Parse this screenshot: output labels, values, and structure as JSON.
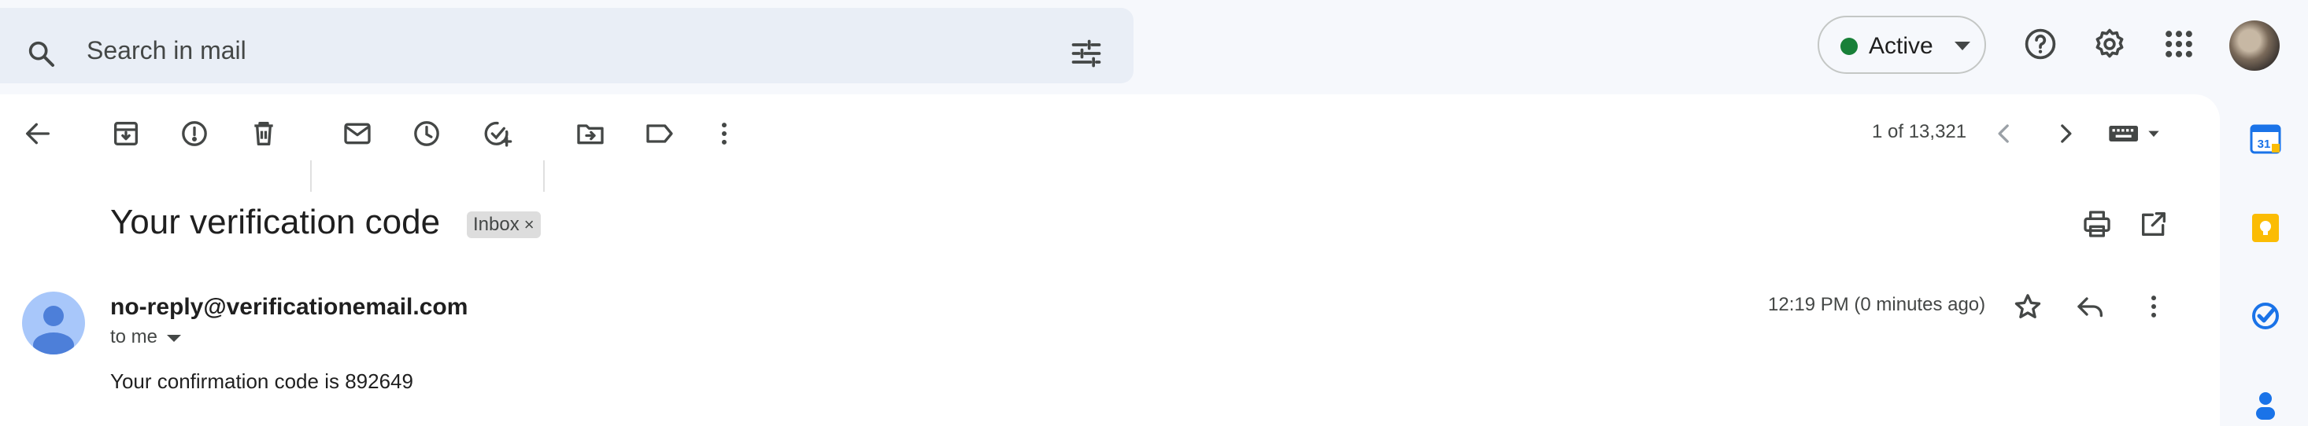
{
  "search": {
    "placeholder": "Search in mail"
  },
  "status": {
    "label": "Active",
    "color": "#188038"
  },
  "toolbar": {
    "icons": [
      "back-arrow-icon",
      "archive-icon",
      "report-spam-icon",
      "delete-icon",
      "mark-unread-icon",
      "snooze-icon",
      "add-to-tasks-icon",
      "move-to-icon",
      "label-icon",
      "more-vert-icon"
    ],
    "pager": "1 of 13,321"
  },
  "message": {
    "subject": "Your verification code",
    "label_chip": "Inbox",
    "chip_remove": "×",
    "sender": "no-reply@verificationemail.com",
    "to": "to me",
    "time": "12:19 PM (0 minutes ago)",
    "body": "Your confirmation code is 892649"
  },
  "side_panel": {
    "calendar_day": "31",
    "apps": [
      "calendar-icon",
      "keep-icon",
      "tasks-icon",
      "contacts-icon"
    ]
  },
  "colors": {
    "background": "#f6f8fc",
    "search_bg": "#e9eef6",
    "accent_blue": "#1a73e8",
    "keep_yellow": "#fbbc04"
  }
}
